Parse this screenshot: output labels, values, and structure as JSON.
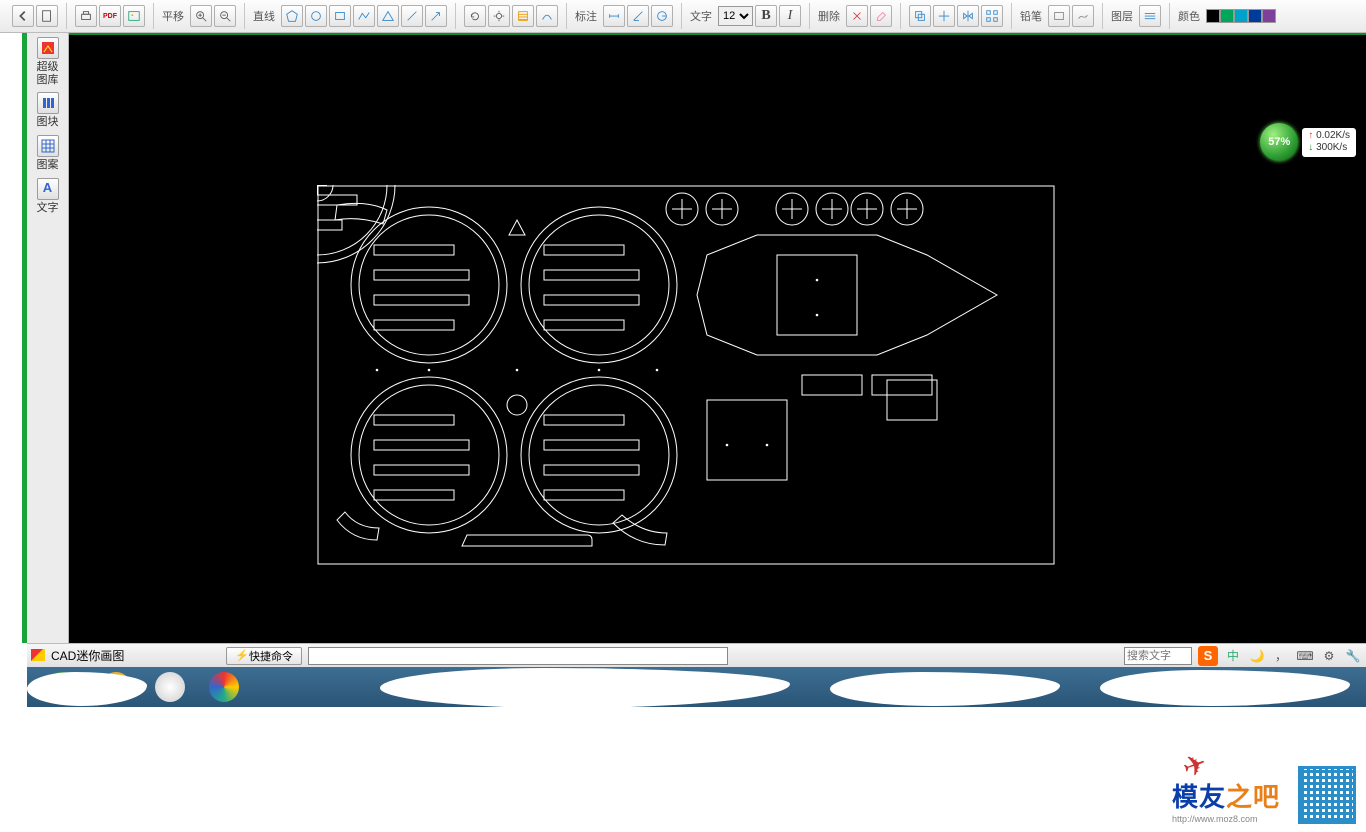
{
  "toolbar": {
    "pan_label": "平移",
    "line_label": "直线",
    "annot_label": "标注",
    "text_label": "文字",
    "del_label": "删除",
    "pencil_label": "铅笔",
    "layer_label": "图层",
    "color_label": "颜色",
    "font_size": "12",
    "bold": "B",
    "italic": "I",
    "swatches": [
      "#000000",
      "#00a65a",
      "#00a2c9",
      "#003a9b",
      "#7e3f9b"
    ]
  },
  "sidebar": {
    "library": "超级\n图库",
    "block": "图块",
    "pattern": "图案",
    "text": "文字"
  },
  "net": {
    "pct": "57%",
    "up": "0.02K/s",
    "dn": "300K/s"
  },
  "status": {
    "app": "CAD迷你画图",
    "cmd_btn": "快捷命令",
    "search_ph": "搜索文字",
    "sogou": "S",
    "ime": "中"
  },
  "watermark": {
    "a": "模友",
    "b": "之吧",
    "url": "http://www.moz8.com"
  }
}
